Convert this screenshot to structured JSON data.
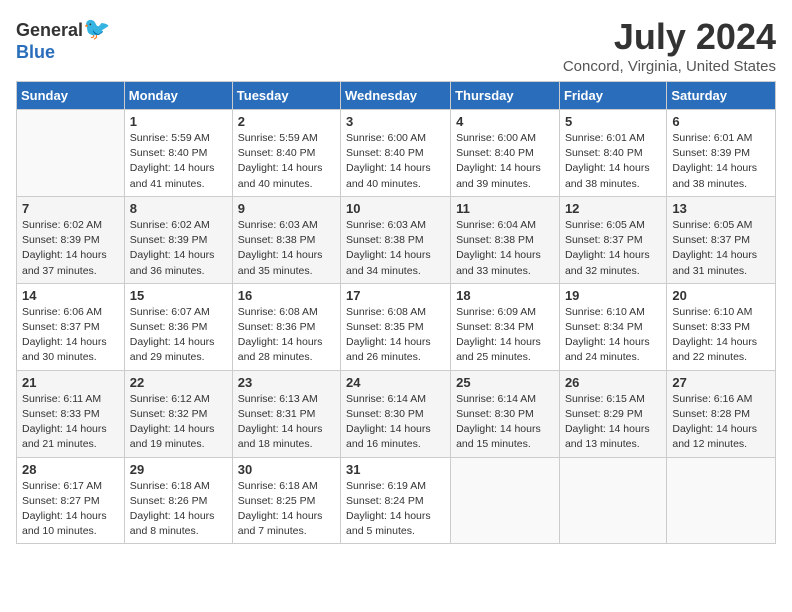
{
  "header": {
    "logo_general": "General",
    "logo_blue": "Blue",
    "title": "July 2024",
    "subtitle": "Concord, Virginia, United States"
  },
  "days_header": [
    "Sunday",
    "Monday",
    "Tuesday",
    "Wednesday",
    "Thursday",
    "Friday",
    "Saturday"
  ],
  "weeks": [
    [
      {
        "num": "",
        "info": ""
      },
      {
        "num": "1",
        "info": "Sunrise: 5:59 AM\nSunset: 8:40 PM\nDaylight: 14 hours\nand 41 minutes."
      },
      {
        "num": "2",
        "info": "Sunrise: 5:59 AM\nSunset: 8:40 PM\nDaylight: 14 hours\nand 40 minutes."
      },
      {
        "num": "3",
        "info": "Sunrise: 6:00 AM\nSunset: 8:40 PM\nDaylight: 14 hours\nand 40 minutes."
      },
      {
        "num": "4",
        "info": "Sunrise: 6:00 AM\nSunset: 8:40 PM\nDaylight: 14 hours\nand 39 minutes."
      },
      {
        "num": "5",
        "info": "Sunrise: 6:01 AM\nSunset: 8:40 PM\nDaylight: 14 hours\nand 38 minutes."
      },
      {
        "num": "6",
        "info": "Sunrise: 6:01 AM\nSunset: 8:39 PM\nDaylight: 14 hours\nand 38 minutes."
      }
    ],
    [
      {
        "num": "7",
        "info": "Sunrise: 6:02 AM\nSunset: 8:39 PM\nDaylight: 14 hours\nand 37 minutes."
      },
      {
        "num": "8",
        "info": "Sunrise: 6:02 AM\nSunset: 8:39 PM\nDaylight: 14 hours\nand 36 minutes."
      },
      {
        "num": "9",
        "info": "Sunrise: 6:03 AM\nSunset: 8:38 PM\nDaylight: 14 hours\nand 35 minutes."
      },
      {
        "num": "10",
        "info": "Sunrise: 6:03 AM\nSunset: 8:38 PM\nDaylight: 14 hours\nand 34 minutes."
      },
      {
        "num": "11",
        "info": "Sunrise: 6:04 AM\nSunset: 8:38 PM\nDaylight: 14 hours\nand 33 minutes."
      },
      {
        "num": "12",
        "info": "Sunrise: 6:05 AM\nSunset: 8:37 PM\nDaylight: 14 hours\nand 32 minutes."
      },
      {
        "num": "13",
        "info": "Sunrise: 6:05 AM\nSunset: 8:37 PM\nDaylight: 14 hours\nand 31 minutes."
      }
    ],
    [
      {
        "num": "14",
        "info": "Sunrise: 6:06 AM\nSunset: 8:37 PM\nDaylight: 14 hours\nand 30 minutes."
      },
      {
        "num": "15",
        "info": "Sunrise: 6:07 AM\nSunset: 8:36 PM\nDaylight: 14 hours\nand 29 minutes."
      },
      {
        "num": "16",
        "info": "Sunrise: 6:08 AM\nSunset: 8:36 PM\nDaylight: 14 hours\nand 28 minutes."
      },
      {
        "num": "17",
        "info": "Sunrise: 6:08 AM\nSunset: 8:35 PM\nDaylight: 14 hours\nand 26 minutes."
      },
      {
        "num": "18",
        "info": "Sunrise: 6:09 AM\nSunset: 8:34 PM\nDaylight: 14 hours\nand 25 minutes."
      },
      {
        "num": "19",
        "info": "Sunrise: 6:10 AM\nSunset: 8:34 PM\nDaylight: 14 hours\nand 24 minutes."
      },
      {
        "num": "20",
        "info": "Sunrise: 6:10 AM\nSunset: 8:33 PM\nDaylight: 14 hours\nand 22 minutes."
      }
    ],
    [
      {
        "num": "21",
        "info": "Sunrise: 6:11 AM\nSunset: 8:33 PM\nDaylight: 14 hours\nand 21 minutes."
      },
      {
        "num": "22",
        "info": "Sunrise: 6:12 AM\nSunset: 8:32 PM\nDaylight: 14 hours\nand 19 minutes."
      },
      {
        "num": "23",
        "info": "Sunrise: 6:13 AM\nSunset: 8:31 PM\nDaylight: 14 hours\nand 18 minutes."
      },
      {
        "num": "24",
        "info": "Sunrise: 6:14 AM\nSunset: 8:30 PM\nDaylight: 14 hours\nand 16 minutes."
      },
      {
        "num": "25",
        "info": "Sunrise: 6:14 AM\nSunset: 8:30 PM\nDaylight: 14 hours\nand 15 minutes."
      },
      {
        "num": "26",
        "info": "Sunrise: 6:15 AM\nSunset: 8:29 PM\nDaylight: 14 hours\nand 13 minutes."
      },
      {
        "num": "27",
        "info": "Sunrise: 6:16 AM\nSunset: 8:28 PM\nDaylight: 14 hours\nand 12 minutes."
      }
    ],
    [
      {
        "num": "28",
        "info": "Sunrise: 6:17 AM\nSunset: 8:27 PM\nDaylight: 14 hours\nand 10 minutes."
      },
      {
        "num": "29",
        "info": "Sunrise: 6:18 AM\nSunset: 8:26 PM\nDaylight: 14 hours\nand 8 minutes."
      },
      {
        "num": "30",
        "info": "Sunrise: 6:18 AM\nSunset: 8:25 PM\nDaylight: 14 hours\nand 7 minutes."
      },
      {
        "num": "31",
        "info": "Sunrise: 6:19 AM\nSunset: 8:24 PM\nDaylight: 14 hours\nand 5 minutes."
      },
      {
        "num": "",
        "info": ""
      },
      {
        "num": "",
        "info": ""
      },
      {
        "num": "",
        "info": ""
      }
    ]
  ]
}
